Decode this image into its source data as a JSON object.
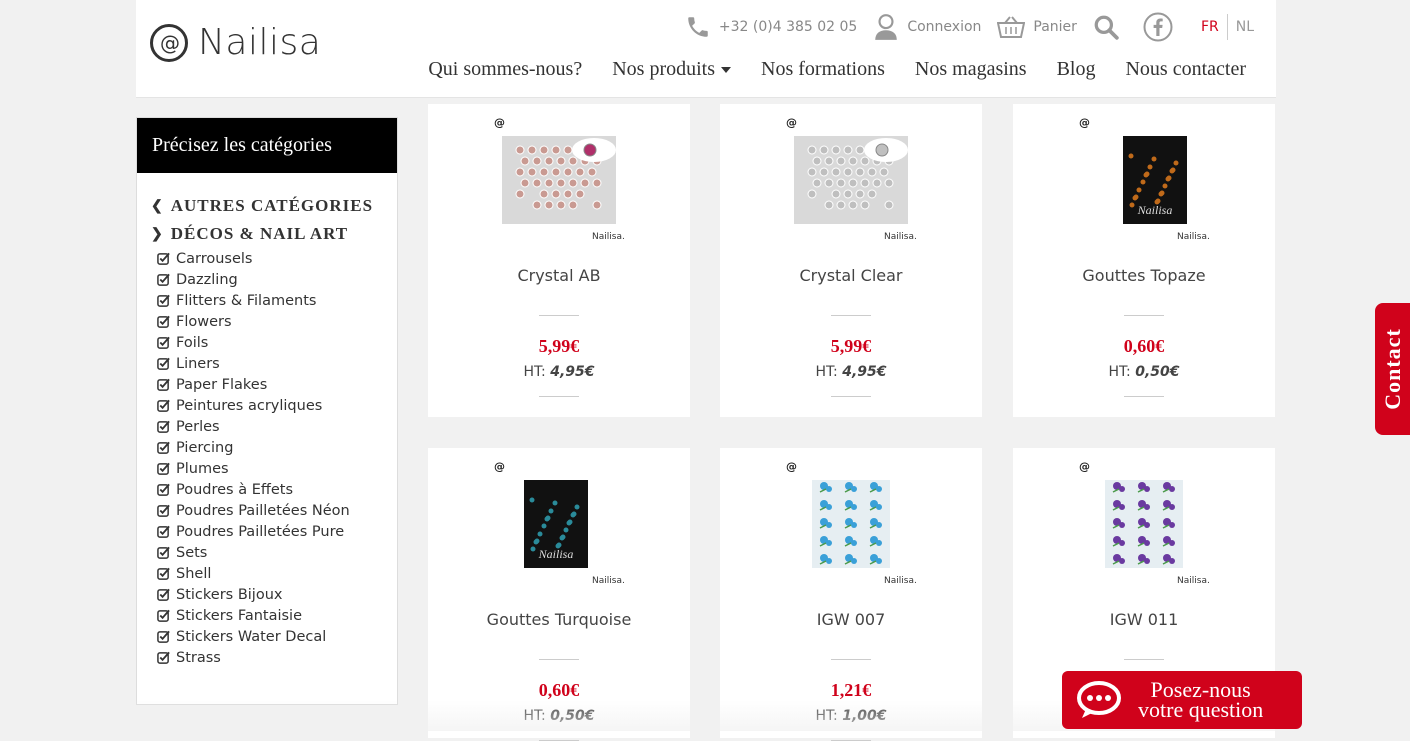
{
  "brand": {
    "name": "Nailisa",
    "mark": "@"
  },
  "topbar": {
    "phone": "+32 (0)4 385 02 05",
    "login": "Connexion",
    "cart": "Panier",
    "lang_fr": "FR",
    "lang_nl": "NL"
  },
  "nav": {
    "about": "Qui sommes-nous?",
    "products": "Nos produits",
    "trainings": "Nos formations",
    "stores": "Nos magasins",
    "blog": "Blog",
    "contact": "Nous contacter"
  },
  "sidebar": {
    "title": "Précisez les catégories",
    "other_categories": "AUTRES CATÉGORIES",
    "current_category": "DÉCOS & NAIL ART",
    "items": [
      "Carrousels",
      "Dazzling",
      "Flitters & Filaments",
      "Flowers",
      "Foils",
      "Liners",
      "Paper Flakes",
      "Peintures acryliques",
      "Perles",
      "Piercing",
      "Plumes",
      "Poudres à Effets",
      "Poudres Pailletées Néon",
      "Poudres Pailletées Pure",
      "Sets",
      "Shell",
      "Stickers Bijoux",
      "Stickers Fantaisie",
      "Stickers Water Decal",
      "Strass"
    ]
  },
  "products": [
    {
      "name": "Crystal AB",
      "price": "5,99€",
      "ht_label": "HT:",
      "ht_price": "4,95€",
      "thumb": "crystal-ab"
    },
    {
      "name": "Crystal Clear",
      "price": "5,99€",
      "ht_label": "HT:",
      "ht_price": "4,95€",
      "thumb": "crystal-clear"
    },
    {
      "name": "Gouttes Topaze",
      "price": "0,60€",
      "ht_label": "HT:",
      "ht_price": "0,50€",
      "thumb": "gouttes-topaze"
    },
    {
      "name": "Gouttes Turquoise",
      "price": "0,60€",
      "ht_label": "HT:",
      "ht_price": "0,50€",
      "thumb": "gouttes-turquoise"
    },
    {
      "name": "IGW 007",
      "price": "1,21€",
      "ht_label": "HT:",
      "ht_price": "1,00€",
      "thumb": "igw-007"
    },
    {
      "name": "IGW 011",
      "price": "",
      "ht_label": "",
      "ht_price": "",
      "thumb": "igw-011"
    }
  ],
  "image_brand_small": "Nailisa.",
  "contact_tab": "Contact",
  "ask_button": {
    "line1": "Posez-nous",
    "line2": "votre question"
  },
  "colors": {
    "accent": "#d0021b",
    "header_bg": "#ffffff",
    "sidebar_title_bg": "#000000"
  }
}
